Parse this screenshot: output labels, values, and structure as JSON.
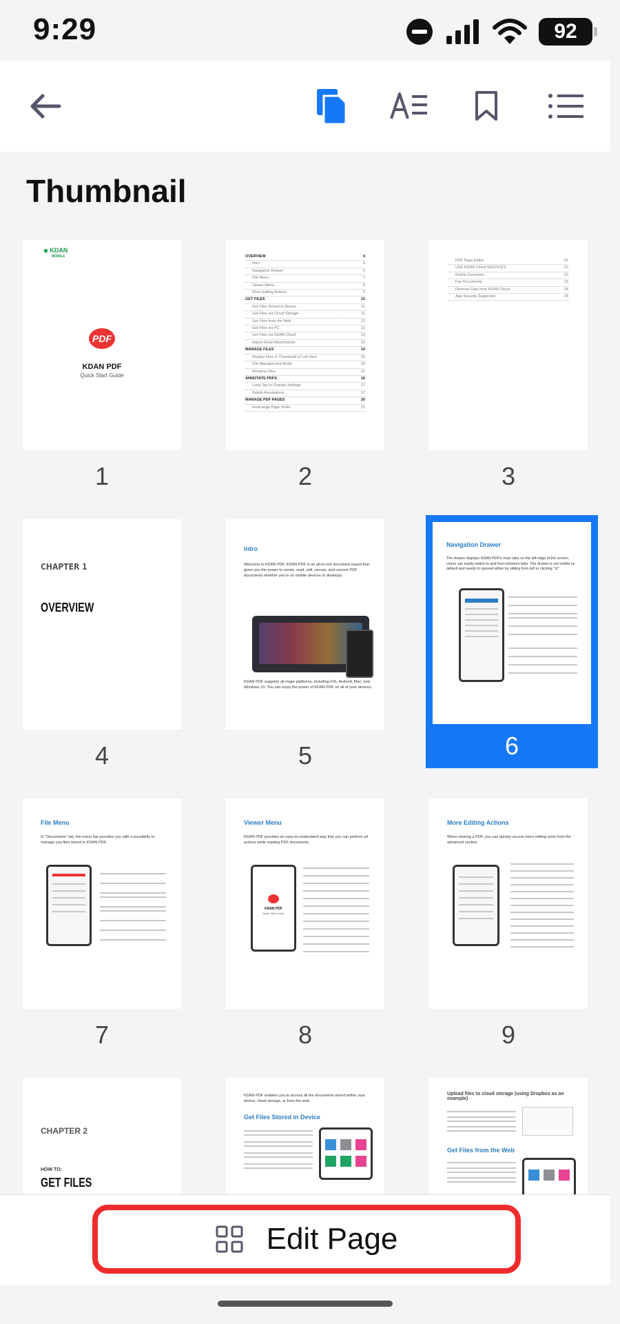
{
  "status_bar": {
    "time": "9:29",
    "battery": "92"
  },
  "toolbar": {
    "back": "back-arrow-icon",
    "thumbnails": "thumbnails-icon",
    "reflow": "text-reflow-icon",
    "bookmark": "bookmark-icon",
    "outline": "outline-list-icon",
    "active_color": "#1778f7",
    "icon_color": "#55566a"
  },
  "section": {
    "title": "Thumbnail"
  },
  "pages": [
    {
      "num": "1",
      "brand": "KDAN",
      "brand_sub": "MOBILE",
      "logo_text": "PDF",
      "title": "KDAN PDF",
      "subtitle": "Quick Start Guide"
    },
    {
      "num": "2",
      "toc": [
        {
          "t": "OVERVIEW",
          "p": "4"
        },
        {
          "t": "Intro",
          "p": "5"
        },
        {
          "t": "Navigation Drawer",
          "p": "6"
        },
        {
          "t": "File Menu",
          "p": "7"
        },
        {
          "t": "Viewer Menu",
          "p": "8"
        },
        {
          "t": "More Editing Actions",
          "p": "9"
        },
        {
          "t": "GET FILES",
          "p": "10"
        },
        {
          "t": "Get Files Stored in Device",
          "p": "11"
        },
        {
          "t": "Get Files via Cloud Storage",
          "p": "11"
        },
        {
          "t": "Get Files from the Web",
          "p": "12"
        },
        {
          "t": "Get Files via PC",
          "p": "12"
        },
        {
          "t": "Get Files via KDAN Cloud",
          "p": "13"
        },
        {
          "t": "Import Email Attachments",
          "p": "13"
        },
        {
          "t": "MANAGE FILES",
          "p": "14"
        },
        {
          "t": "Display Files in Thumbnail or List View",
          "p": "15"
        },
        {
          "t": "File Management Mode",
          "p": "15"
        },
        {
          "t": "Rename Files",
          "p": "15"
        },
        {
          "t": "ANNOTATE PDFS",
          "p": "16"
        },
        {
          "t": "Long Tap to Change Settings",
          "p": "17"
        },
        {
          "t": "Delete Annotations",
          "p": "17"
        },
        {
          "t": "MANAGE PDF PAGES",
          "p": "20"
        },
        {
          "t": "Rearrange Page Order",
          "p": "21"
        }
      ]
    },
    {
      "num": "3",
      "toc": [
        {
          "t": "PDF Page Editor",
          "p": "21"
        },
        {
          "t": "USE KDAN Cloud SERVICES",
          "p": "22"
        },
        {
          "t": "Online Converter",
          "p": "23"
        },
        {
          "t": "Fax Documents",
          "p": "23"
        },
        {
          "t": "Remove Files from KDAN Cloud",
          "p": "24"
        },
        {
          "t": "App Security Supported",
          "p": "24"
        }
      ]
    },
    {
      "num": "4",
      "chapter": "CHAPTER 1",
      "heading": "OVERVIEW"
    },
    {
      "num": "5",
      "heading": "Intro",
      "body": "Welcome to KDAN PDF. KDAN PDF is an all-in-one document expert that gives you the power to create, read, edit, secure, and convert PDF documents whether you're on mobile devices or desktops.",
      "footer": "KDAN PDF supports all major platforms, including iOS, Android, Mac, and Windows 10. You can enjoy the power of KDAN PDF on all of your devices."
    },
    {
      "num": "6",
      "heading": "Navigation Drawer",
      "body": "The drawer displays KDAN PDF's main tabs on the left edge of the screen. Users can easily switch to and from between tabs. The drawer is not visible by default and needs to opened either by sliding from left or clicking \"☰\"."
    },
    {
      "num": "7",
      "heading": "File Menu",
      "body": "In \"Documents\" tab, the menu bar provides you with a possibility to manage you files stored in KDAN PDF."
    },
    {
      "num": "8",
      "heading": "Viewer Menu",
      "body": "KDAN PDF provides an easy-to-understand way that you can perform all actions while reading PDF documents.",
      "title": "KDAN PDF",
      "subtitle": "Quick Start Guide"
    },
    {
      "num": "9",
      "heading": "More Editing Actions",
      "body": "When viewing a PDF, you can quickly access more editing tools from the advanced section."
    },
    {
      "num": "10",
      "chapter": "CHAPTER 2",
      "howto": "HOW TO:",
      "heading": "GET FILES"
    },
    {
      "num": "11",
      "intro": "KDAN PDF enables you to access all the documents stored within your device, cloud storage, or from the web.",
      "heading": "Get Files Stored in Device"
    },
    {
      "num": "12",
      "heading_a": "Upload files to cloud storage (using Dropbox as an example)",
      "heading": "Get Files from the Web"
    }
  ],
  "selected_page": "6",
  "bottom": {
    "edit_label": "Edit Page",
    "highlight_color": "#ef2b2b"
  }
}
